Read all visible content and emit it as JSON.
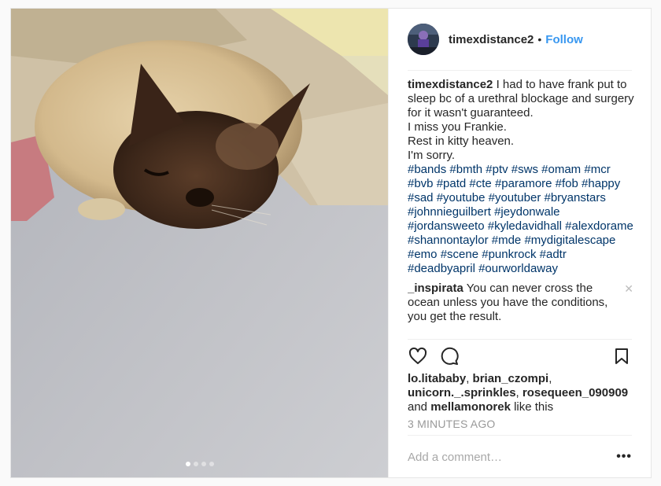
{
  "post": {
    "username": "timexdistance2",
    "separator": "•",
    "follow_label": "Follow",
    "caption": {
      "username": "timexdistance2",
      "first_text": "I had to have frank put to sleep bc of a urethral blockage and surgery for it wasn't guaranteed.",
      "lines": [
        "I miss you Frankie.",
        "Rest in kitty heaven.",
        "I'm sorry."
      ]
    },
    "hashtags": [
      "#bands",
      "#bmth",
      "#ptv",
      "#sws",
      "#omam",
      "#mcr",
      "#bvb",
      "#patd",
      "#cte",
      "#paramore",
      "#fob",
      "#happy",
      "#sad",
      "#youtube",
      "#youtuber",
      "#bryanstars",
      "#johnnieguilbert",
      "#jeydonwale",
      "#jordansweeto",
      "#kyledavidhall",
      "#alexdorame",
      "#shannontaylor",
      "#mde",
      "#mydigitalescape",
      "#emo",
      "#scene",
      "#punkrock",
      "#adtr",
      "#deadbyapril",
      "#ourworldaway"
    ],
    "comment": {
      "username": "_inspirata",
      "text": "You can never cross the ocean unless you have the conditions, you get the result.",
      "close_glyph": "✕"
    },
    "likes": {
      "users": [
        "lo.litababy",
        "brian_czompi",
        "unicorn._.sprinkles",
        "rosequeen_090909",
        "mellamonorek"
      ],
      "and_label": "and",
      "suffix": "like this"
    },
    "timestamp": "3 MINUTES AGO",
    "add_comment_placeholder": "Add a comment…",
    "more_label": "•••",
    "carousel": {
      "count": 4,
      "active": 0
    }
  },
  "icons": {
    "like": "heart-icon",
    "comment": "comment-bubble-icon",
    "save": "bookmark-icon",
    "more": "more-options-icon"
  },
  "colors": {
    "accent": "#3897f0",
    "hashtag": "#003569",
    "muted": "#999999",
    "border": "#efefef"
  }
}
